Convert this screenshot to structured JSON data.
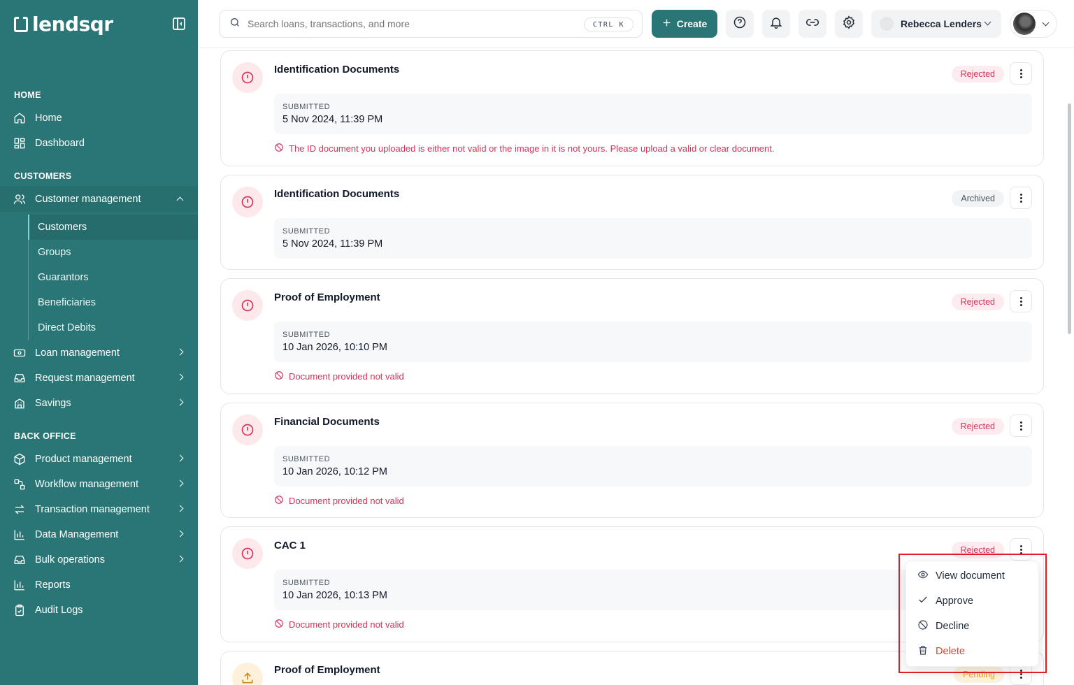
{
  "brand": {
    "name": "lendsqr"
  },
  "sidebar": {
    "sections": {
      "home": "HOME",
      "customers": "CUSTOMERS",
      "back_office": "BACK OFFICE"
    },
    "items": {
      "home": "Home",
      "dashboard": "Dashboard",
      "customer_management": "Customer management",
      "loan_management": "Loan management",
      "request_management": "Request management",
      "savings": "Savings",
      "product_management": "Product management",
      "workflow_management": "Workflow management",
      "transaction_management": "Transaction management",
      "data_management": "Data Management",
      "bulk_operations": "Bulk operations",
      "reports": "Reports",
      "audit_logs": "Audit Logs"
    },
    "sub_items": {
      "customers": "Customers",
      "groups": "Groups",
      "guarantors": "Guarantors",
      "beneficiaries": "Beneficiaries",
      "direct_debits": "Direct Debits"
    }
  },
  "topbar": {
    "search_placeholder": "Search loans, transactions, and more",
    "shortcut": "CTRL K",
    "create_label": "Create",
    "user_name": "Rebecca Lenders"
  },
  "documents": [
    {
      "title": "Identification Documents",
      "status": "Rejected",
      "submitted_label": "SUBMITTED",
      "submitted": "5 Nov 2024, 11:39 PM",
      "reason": "The ID document you uploaded is either not valid or the image in it is not yours. Please upload a valid or clear document."
    },
    {
      "title": "Identification Documents",
      "status": "Archived",
      "submitted_label": "SUBMITTED",
      "submitted": "5 Nov 2024, 11:39 PM"
    },
    {
      "title": "Proof of Employment",
      "status": "Rejected",
      "submitted_label": "SUBMITTED",
      "submitted": "10 Jan 2026, 10:10 PM",
      "reason": "Document provided not valid"
    },
    {
      "title": "Financial Documents",
      "status": "Rejected",
      "submitted_label": "SUBMITTED",
      "submitted": "10 Jan 2026, 10:12 PM",
      "reason": "Document provided not valid"
    },
    {
      "title": "CAC 1",
      "status": "Rejected",
      "submitted_label": "SUBMITTED",
      "submitted": "10 Jan 2026, 10:13 PM",
      "reason": "Document provided not valid"
    },
    {
      "title": "Proof of Employment",
      "status": "Pending"
    }
  ],
  "menu": {
    "view": "View document",
    "approve": "Approve",
    "decline": "Decline",
    "delete": "Delete"
  },
  "colors": {
    "brand": "#2a7676",
    "danger": "#d6335a",
    "pending": "#f2a21f",
    "highlight": "#e11d24"
  }
}
